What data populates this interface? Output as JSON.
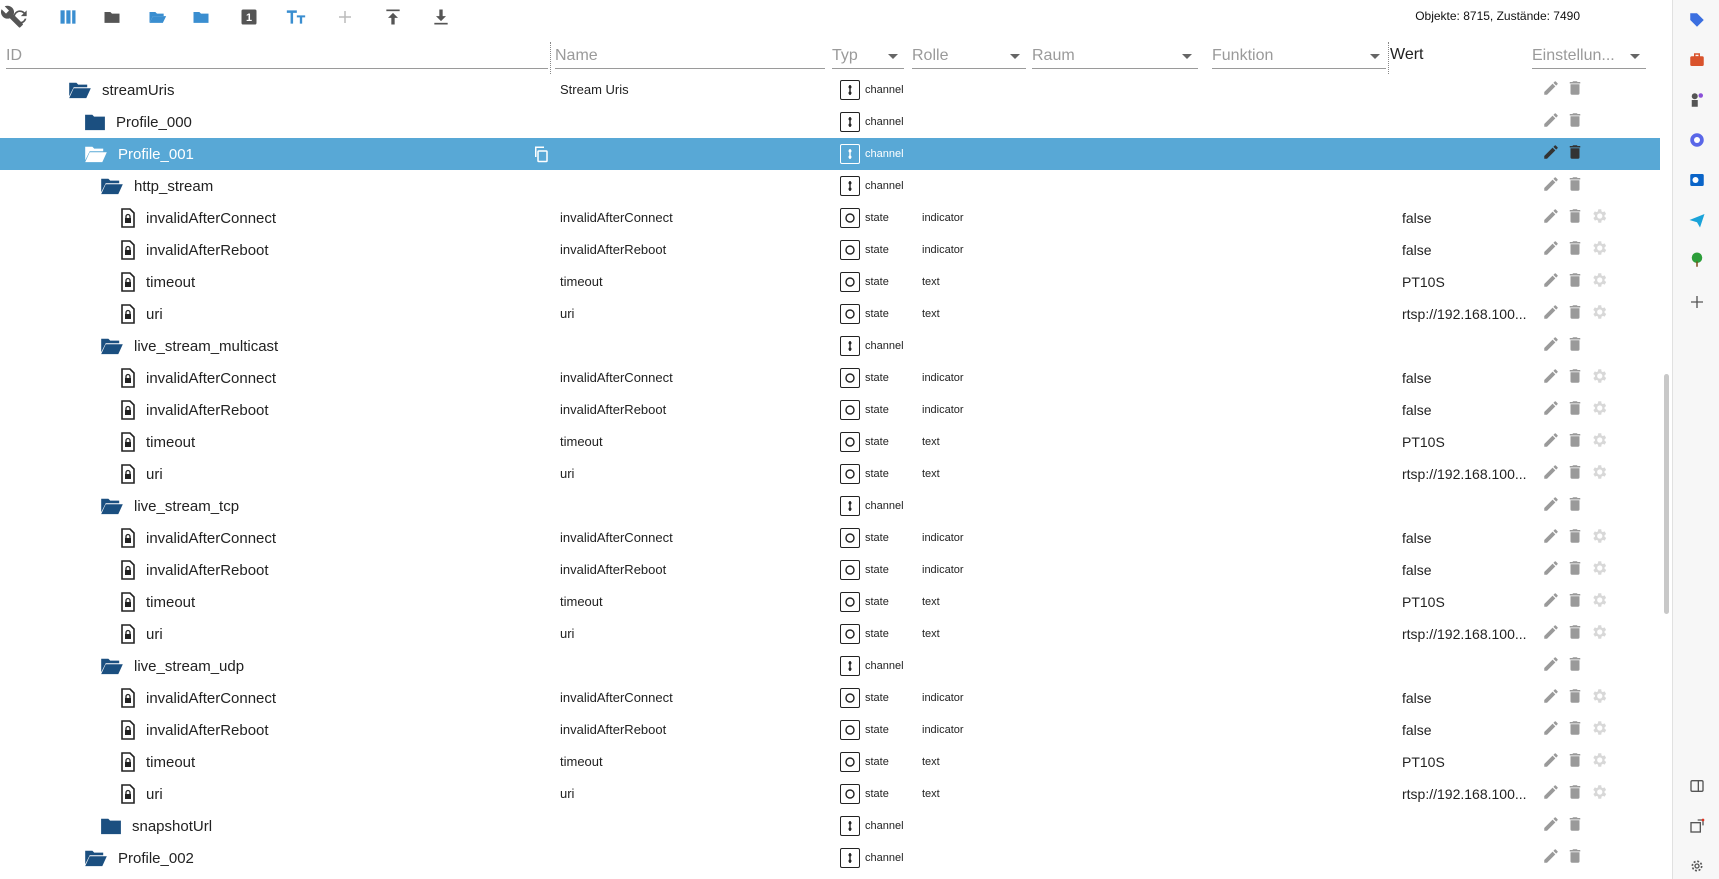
{
  "stats": "Objekte: 8715, Zustände: 7490",
  "columns": {
    "id": "ID",
    "name": "Name",
    "typ": "Typ",
    "rolle": "Rolle",
    "raum": "Raum",
    "funktion": "Funktion",
    "wert": "Wert",
    "einstellungen": "Einstellun..."
  },
  "rows": [
    {
      "indent": 0,
      "icon": "folder-open",
      "id": "streamUris",
      "name": "Stream Uris",
      "type": "channel",
      "role": "",
      "value": "",
      "gear": false,
      "selected": false
    },
    {
      "indent": 1,
      "icon": "folder",
      "id": "Profile_000",
      "name": "",
      "type": "channel",
      "role": "",
      "value": "",
      "gear": false,
      "selected": false
    },
    {
      "indent": 1,
      "icon": "folder-open",
      "id": "Profile_001",
      "name": "",
      "type": "channel",
      "role": "",
      "value": "",
      "gear": false,
      "selected": true
    },
    {
      "indent": 2,
      "icon": "folder-open",
      "id": "http_stream",
      "name": "",
      "type": "channel",
      "role": "",
      "value": "",
      "gear": false,
      "selected": false
    },
    {
      "indent": 3,
      "icon": "file",
      "id": "invalidAfterConnect",
      "name": "invalidAfterConnect",
      "type": "state",
      "role": "indicator",
      "value": "false",
      "gear": true,
      "selected": false
    },
    {
      "indent": 3,
      "icon": "file",
      "id": "invalidAfterReboot",
      "name": "invalidAfterReboot",
      "type": "state",
      "role": "indicator",
      "value": "false",
      "gear": true,
      "selected": false
    },
    {
      "indent": 3,
      "icon": "file",
      "id": "timeout",
      "name": "timeout",
      "type": "state",
      "role": "text",
      "value": "PT10S",
      "gear": true,
      "selected": false
    },
    {
      "indent": 3,
      "icon": "file",
      "id": "uri",
      "name": "uri",
      "type": "state",
      "role": "text",
      "value": "rtsp://192.168.100...",
      "gear": true,
      "selected": false
    },
    {
      "indent": 2,
      "icon": "folder-open",
      "id": "live_stream_multicast",
      "name": "",
      "type": "channel",
      "role": "",
      "value": "",
      "gear": false,
      "selected": false
    },
    {
      "indent": 3,
      "icon": "file",
      "id": "invalidAfterConnect",
      "name": "invalidAfterConnect",
      "type": "state",
      "role": "indicator",
      "value": "false",
      "gear": true,
      "selected": false
    },
    {
      "indent": 3,
      "icon": "file",
      "id": "invalidAfterReboot",
      "name": "invalidAfterReboot",
      "type": "state",
      "role": "indicator",
      "value": "false",
      "gear": true,
      "selected": false
    },
    {
      "indent": 3,
      "icon": "file",
      "id": "timeout",
      "name": "timeout",
      "type": "state",
      "role": "text",
      "value": "PT10S",
      "gear": true,
      "selected": false
    },
    {
      "indent": 3,
      "icon": "file",
      "id": "uri",
      "name": "uri",
      "type": "state",
      "role": "text",
      "value": "rtsp://192.168.100...",
      "gear": true,
      "selected": false
    },
    {
      "indent": 2,
      "icon": "folder-open",
      "id": "live_stream_tcp",
      "name": "",
      "type": "channel",
      "role": "",
      "value": "",
      "gear": false,
      "selected": false
    },
    {
      "indent": 3,
      "icon": "file",
      "id": "invalidAfterConnect",
      "name": "invalidAfterConnect",
      "type": "state",
      "role": "indicator",
      "value": "false",
      "gear": true,
      "selected": false
    },
    {
      "indent": 3,
      "icon": "file",
      "id": "invalidAfterReboot",
      "name": "invalidAfterReboot",
      "type": "state",
      "role": "indicator",
      "value": "false",
      "gear": true,
      "selected": false
    },
    {
      "indent": 3,
      "icon": "file",
      "id": "timeout",
      "name": "timeout",
      "type": "state",
      "role": "text",
      "value": "PT10S",
      "gear": true,
      "selected": false
    },
    {
      "indent": 3,
      "icon": "file",
      "id": "uri",
      "name": "uri",
      "type": "state",
      "role": "text",
      "value": "rtsp://192.168.100...",
      "gear": true,
      "selected": false
    },
    {
      "indent": 2,
      "icon": "folder-open",
      "id": "live_stream_udp",
      "name": "",
      "type": "channel",
      "role": "",
      "value": "",
      "gear": false,
      "selected": false
    },
    {
      "indent": 3,
      "icon": "file",
      "id": "invalidAfterConnect",
      "name": "invalidAfterConnect",
      "type": "state",
      "role": "indicator",
      "value": "false",
      "gear": true,
      "selected": false
    },
    {
      "indent": 3,
      "icon": "file",
      "id": "invalidAfterReboot",
      "name": "invalidAfterReboot",
      "type": "state",
      "role": "indicator",
      "value": "false",
      "gear": true,
      "selected": false
    },
    {
      "indent": 3,
      "icon": "file",
      "id": "timeout",
      "name": "timeout",
      "type": "state",
      "role": "text",
      "value": "PT10S",
      "gear": true,
      "selected": false
    },
    {
      "indent": 3,
      "icon": "file",
      "id": "uri",
      "name": "uri",
      "type": "state",
      "role": "text",
      "value": "rtsp://192.168.100...",
      "gear": true,
      "selected": false
    },
    {
      "indent": 2,
      "icon": "folder",
      "id": "snapshotUrl",
      "name": "",
      "type": "channel",
      "role": "",
      "value": "",
      "gear": false,
      "selected": false
    },
    {
      "indent": 1,
      "icon": "folder-open",
      "id": "Profile_002",
      "name": "",
      "type": "channel",
      "role": "",
      "value": "",
      "gear": false,
      "selected": false
    }
  ],
  "colors": {
    "folder": "#1b4f80",
    "toolbar_blue": "#3a8ed0",
    "selected_row": "#58a8d6",
    "action_gray": "#9a9a9a"
  }
}
